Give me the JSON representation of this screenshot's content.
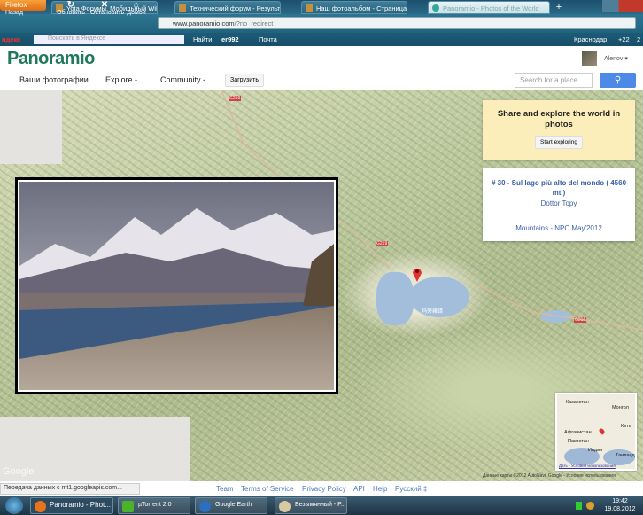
{
  "browser": {
    "menu_button": "Firefox",
    "tabs": [
      {
        "title": "Yota Форумы. Мобильный WiMAX от..."
      },
      {
        "title": "Технический форум - Результаты п..."
      },
      {
        "title": "Наш фотоальбом - Страница 288 - ..."
      },
      {
        "title": "Panoramio - Photos of the World",
        "active": true
      }
    ],
    "nav": {
      "back": "Назад",
      "reload": "Обновить",
      "stop": "Остановить",
      "home": "Домой"
    },
    "url_domain": "www.panoramio.com",
    "url_path": "/?no_redirect",
    "yandex": {
      "logo": "ндекс",
      "search_placeholder": "Поискать в Яндексе",
      "find": "Найти",
      "user": "er992",
      "mail": "Почта",
      "city": "Краснодар",
      "temp": "+22",
      "extra": "2"
    }
  },
  "site": {
    "logo": "Panoramio",
    "user": "Alenov",
    "nav": [
      "Ваши фотографии",
      "Explore",
      "Community"
    ],
    "upload": "Загрузить",
    "search_placeholder": "Search for a place",
    "search_icon": "magnifier-icon"
  },
  "promo": {
    "title": "Share and explore the world in photos",
    "button": "Start exploring"
  },
  "photo_info": {
    "title": "# 30 - Sul lago più alto del mondo ( 4560 mt )",
    "author": "Dottor Topy",
    "group": "Mountains - NPC May'2012"
  },
  "map": {
    "road_labels": [
      "G219",
      "G219",
      "G216"
    ],
    "lake_label": "玛旁雍错",
    "google": "Google",
    "copyright": "Данные карты ©2012 AutoNavi, Google - Условия использования",
    "minimap": {
      "labels": [
        "Казахстан",
        "Монгол",
        "Китa",
        "Афганистан",
        "Пакистан",
        "Индия",
        "Таиланд"
      ],
      "footer": "Дать - Условия использования"
    }
  },
  "status": {
    "message": "Передача данных с mt1.googleapis.com..."
  },
  "footer": {
    "links": [
      "Team",
      "Terms of Service",
      "Privacy Policy",
      "API",
      "Help"
    ],
    "language": "Русский ‡"
  },
  "taskbar": {
    "items": [
      "Panoramio - Phot...",
      "µTorrent 2.0",
      "Google Earth",
      "Безымянный - P..."
    ],
    "time": "19:42",
    "date": "19.08.2012"
  },
  "colors": {
    "accent": "#4d8ae8",
    "link": "#3b5fa6",
    "promo_bg": "#fbeebb"
  }
}
